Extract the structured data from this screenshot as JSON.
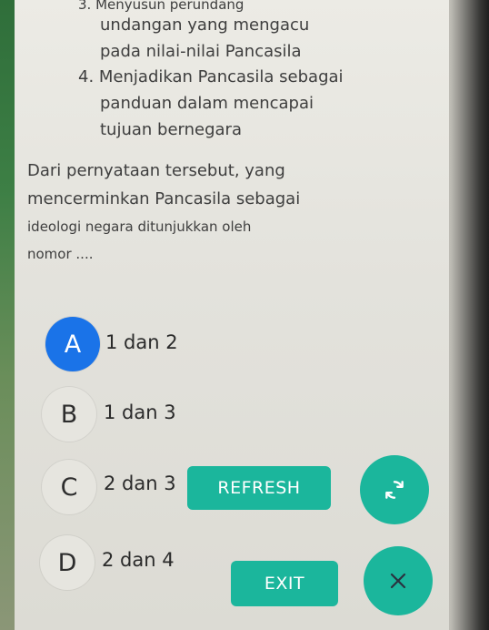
{
  "question": {
    "lines": [
      "3. Menyusun perundang",
      "undangan yang mengacu",
      "pada nilai-nilai Pancasila",
      "4. Menjadikan Pancasila sebagai",
      "panduan dalam mencapai",
      "tujuan bernegara",
      "Dari pernyataan tersebut, yang",
      "mencerminkan Pancasila sebagai",
      "ideologi negara ditunjukkan oleh",
      "nomor ...."
    ]
  },
  "options": [
    {
      "letter": "A",
      "text": "1 dan 2"
    },
    {
      "letter": "B",
      "text": "1 dan 3"
    },
    {
      "letter": "C",
      "text": "2 dan 3"
    },
    {
      "letter": "D",
      "text": "2 dan 4"
    }
  ],
  "buttons": {
    "refresh_label": "REFRESH",
    "exit_label": "EXIT"
  },
  "icons": {
    "refresh": "refresh-icon",
    "close": "close-icon"
  },
  "colors": {
    "selected": "#1a73e8",
    "accent": "#1bb69c"
  }
}
